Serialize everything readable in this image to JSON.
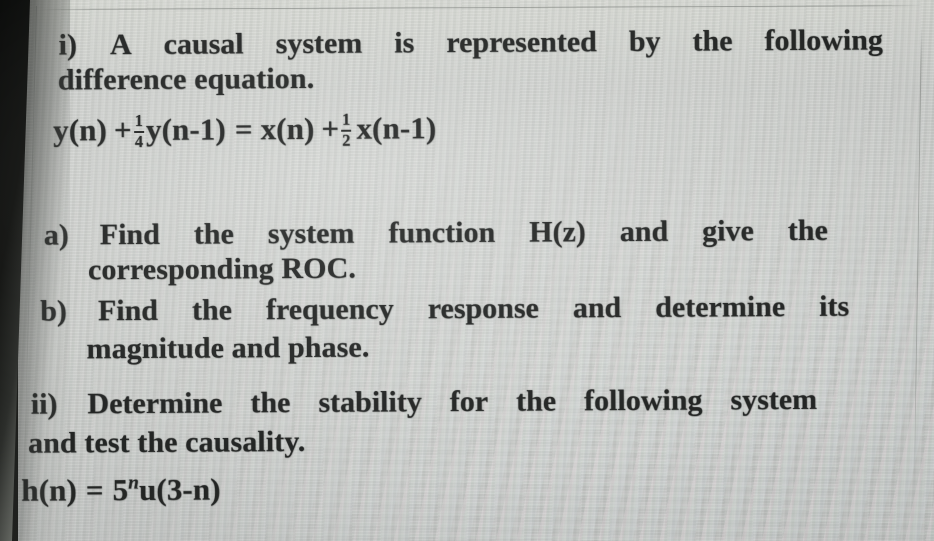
{
  "document": {
    "kind": "photographed-exam-question-sheet",
    "subject_hint": "Digital Signal Processing",
    "paper_color": "#c9cbc8",
    "ink_color": "#232524",
    "edge_shadow_color": "#0a0b0a"
  },
  "question_i": {
    "marker": "i)",
    "stem_line1_words": [
      "A",
      "causal",
      "system",
      "is",
      "represented",
      "by",
      "the",
      "following"
    ],
    "stem_line2": "difference equation.",
    "equation": {
      "lhs_term1": "y(n)",
      "plus1": "+",
      "coeff1": {
        "numerator": "1",
        "denominator": "4"
      },
      "lhs_term2": "y(n-1)",
      "equals": "=",
      "rhs_term1": "x(n)",
      "plus2": "+",
      "coeff2": {
        "numerator": "1",
        "denominator": "2"
      },
      "rhs_term2": "x(n-1)",
      "plain_text": "y(n) + (1/4)y(n-1) = x(n) + (1/2)x(n-1)"
    },
    "parts": [
      {
        "marker": "a)",
        "line1_words": [
          "Find",
          "the",
          "system",
          "function",
          "H(z)",
          "and",
          "give",
          "the"
        ],
        "line2": "corresponding ROC."
      },
      {
        "marker": "b)",
        "line1_words": [
          "Find",
          "the",
          "frequency",
          "response",
          "and",
          "determine",
          "its"
        ],
        "line2": "magnitude and phase."
      }
    ]
  },
  "question_ii": {
    "marker": "ii)",
    "line1_words": [
      "Determine",
      "the",
      "stability",
      "for",
      "the",
      "following",
      "system"
    ],
    "line2": "and test the causality.",
    "impulse_response": {
      "lhs": "h(n)",
      "equals": "=",
      "base": "5",
      "exponent": "n",
      "step_function": "u(3-n)",
      "plain_text": "h(n) = 5^n u(3-n)"
    }
  }
}
